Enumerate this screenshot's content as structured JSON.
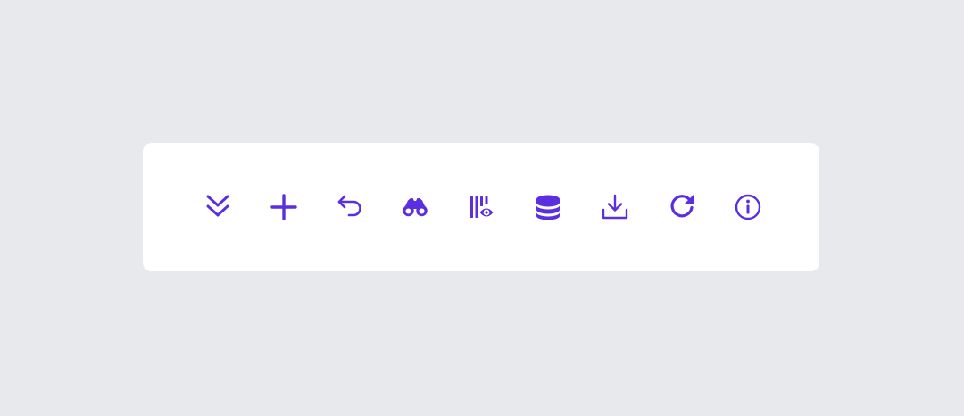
{
  "theme": {
    "icon_color": "#5b2ee0",
    "panel_color": "#ffffff",
    "background_color": "#e8e9ed"
  },
  "toolbar": {
    "items": [
      {
        "icon": "chevrons-down-icon"
      },
      {
        "icon": "plus-icon"
      },
      {
        "icon": "undo-arrow-icon"
      },
      {
        "icon": "binoculars-icon"
      },
      {
        "icon": "column-visibility-icon"
      },
      {
        "icon": "database-icon"
      },
      {
        "icon": "download-icon"
      },
      {
        "icon": "refresh-icon"
      },
      {
        "icon": "info-circle-icon"
      }
    ]
  }
}
